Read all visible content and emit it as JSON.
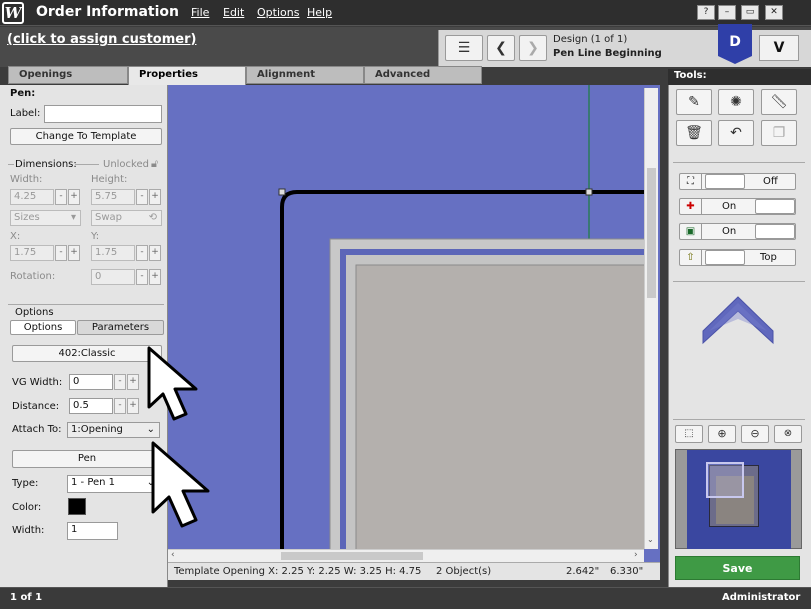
{
  "window": {
    "logo": "W",
    "title": "Order Information",
    "menus": [
      "File",
      "Edit",
      "Options",
      "Help"
    ],
    "controls": [
      "help-icon",
      "minimize-icon",
      "restore-icon",
      "close-icon"
    ]
  },
  "customer": {
    "link": "(click to assign customer)"
  },
  "nav": {
    "design_label": "Design  (1 of 1)",
    "design_sub": "Pen Line Beginning",
    "d_badge": "D",
    "v_button": "V"
  },
  "tabs": [
    "Openings",
    "Properties",
    "Alignment",
    "Advanced"
  ],
  "pen": {
    "section": "Pen:",
    "label_text": "Label:",
    "label_value": "",
    "change_template": "Change To Template",
    "dimensions": "Dimensions:",
    "unlocked": "Unlocked",
    "width_lbl": "Width:",
    "width_val": "4.25",
    "height_lbl": "Height:",
    "height_val": "5.75",
    "sizes": "Sizes",
    "swap": "Swap",
    "x_lbl": "X:",
    "x_val": "1.75",
    "y_lbl": "Y:",
    "y_val": "1.75",
    "rotation_lbl": "Rotation:",
    "rotation_val": "0"
  },
  "options": {
    "section": "Options",
    "subtab_options": "Options",
    "subtab_parameters": "Parameters",
    "profile": "402:Classic",
    "vg_width_lbl": "VG Width:",
    "vg_width_val": "0",
    "distance_lbl": "Distance:",
    "distance_val": "0.5",
    "attach_lbl": "Attach To:",
    "attach_val": "1:Opening",
    "pen_btn": "Pen",
    "type_lbl": "Type:",
    "type_val": "1 - Pen 1",
    "color_lbl": "Color:",
    "color_val": "#000000",
    "width_lbl": "Width:",
    "width_val": "1"
  },
  "status": {
    "text": "Template Opening  X: 2.25  Y: 2.25  W: 3.25  H: 4.75",
    "objects": "2 Object(s)",
    "coord1": "2.642\"",
    "coord2": "6.330\""
  },
  "tools": {
    "header": "Tools:",
    "toggle1": "Off",
    "toggle2": "On",
    "toggle3": "On",
    "toggle4": "Top",
    "save": "Save"
  },
  "bottom": {
    "page": "1 of 1",
    "user": "Administrator"
  },
  "colors": {
    "canvas": "#6670c2",
    "accent_blue": "#2f3fa8",
    "save_green": "#3f9a45"
  }
}
